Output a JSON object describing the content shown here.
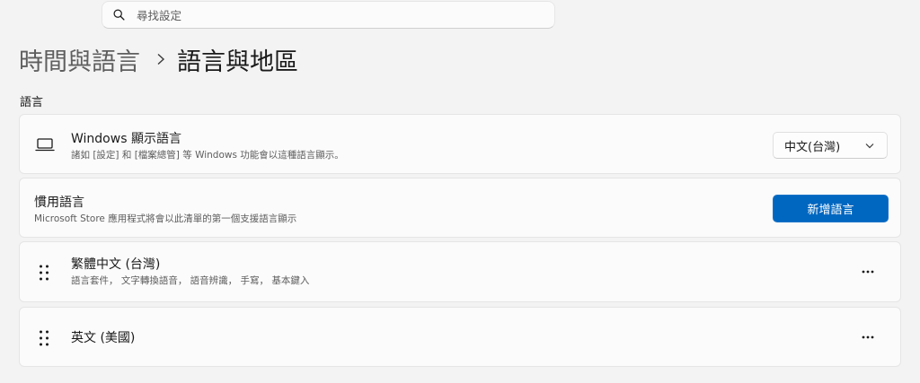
{
  "search": {
    "placeholder": "尋找設定",
    "icon": "search-icon"
  },
  "breadcrumb": {
    "parent": "時間與語言",
    "separator_icon": "chevron-right-icon",
    "current": "語言與地區"
  },
  "section": {
    "label": "語言"
  },
  "display_language": {
    "icon": "laptop-icon",
    "title": "Windows 顯示語言",
    "subtitle": "諸如 [設定] 和 [檔案總管] 等 Windows 功能會以這種語言顯示。",
    "dropdown_value": "中文(台灣)"
  },
  "preferred_languages": {
    "title": "慣用語言",
    "subtitle": "Microsoft Store 應用程式將會以此清單的第一個支援語言顯示",
    "add_button_label": "新增語言"
  },
  "languages": [
    {
      "name": "繁體中文 (台灣)",
      "features": "語言套件， 文字轉換語音， 語音辨識， 手寫， 基本鍵入"
    },
    {
      "name": "英文 (美國)",
      "features": ""
    }
  ],
  "colors": {
    "accent": "#0067c0",
    "background": "#f3f3f3",
    "card": "#fbfbfb"
  }
}
